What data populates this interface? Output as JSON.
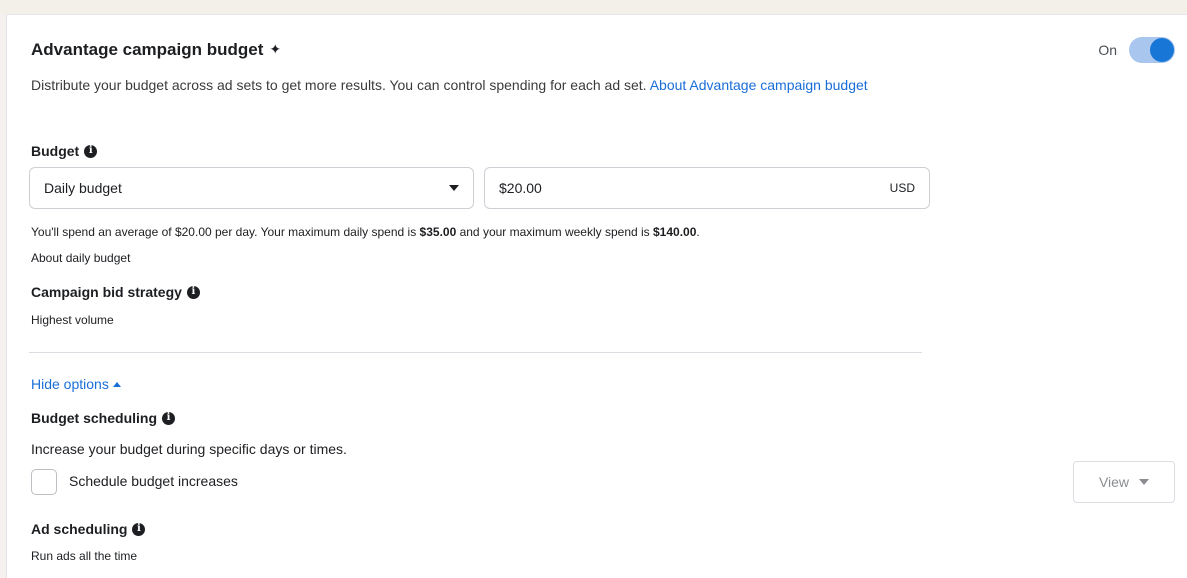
{
  "campaign_budget": {
    "title": "Advantage campaign budget",
    "sparkle_icon": "✦",
    "toggle_label": "On",
    "toggle_on": true,
    "description": "Distribute your budget across ad sets to get more results. You can control spending for each ad set.",
    "about_link": "About Advantage campaign budget"
  },
  "budget": {
    "label": "Budget",
    "type_value": "Daily budget",
    "amount_value": "$20.00",
    "currency": "USD",
    "spend_text_1": "You'll spend an average of $20.00 per day. Your maximum daily spend is ",
    "max_daily": "$35.00",
    "spend_text_2": " and your maximum weekly spend is ",
    "max_weekly": "$140.00",
    "spend_text_3": ".",
    "about_link": "About daily budget"
  },
  "bid_strategy": {
    "label": "Campaign bid strategy",
    "value": "Highest volume"
  },
  "options": {
    "hide_label": "Hide options"
  },
  "budget_scheduling": {
    "label": "Budget scheduling",
    "description": "Increase your budget during specific days or times.",
    "checkbox_label": "Schedule budget increases",
    "checked": false,
    "view_label": "View"
  },
  "ad_scheduling": {
    "label": "Ad scheduling",
    "value": "Run ads all the time"
  },
  "colors": {
    "link": "#1a6ed8",
    "toggle_on": "#1877d6",
    "border": "#ccd0d5"
  }
}
